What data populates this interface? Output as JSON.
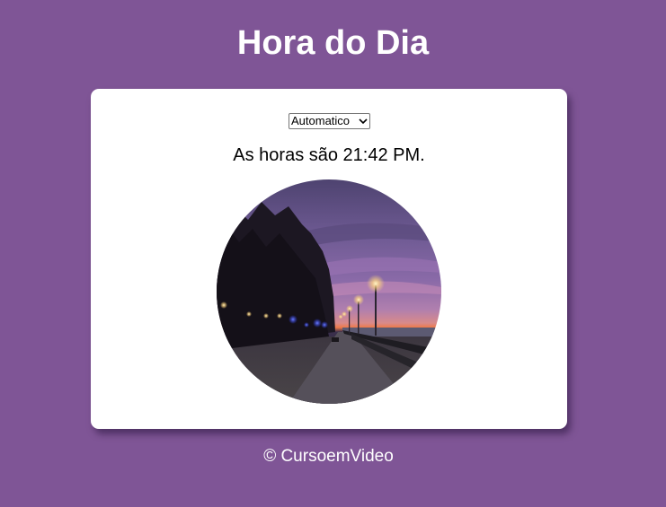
{
  "header": {
    "title": "Hora do Dia"
  },
  "card": {
    "mode_select": {
      "selected": "Automatico"
    },
    "time_message": "As horas são 21:42 PM.",
    "photo_icon": "night-waterfront-promenade-image"
  },
  "footer": {
    "text": "© CursoemVideo"
  },
  "colors": {
    "background": "#7f5596",
    "card": "#ffffff",
    "title_text": "#ffffff"
  }
}
